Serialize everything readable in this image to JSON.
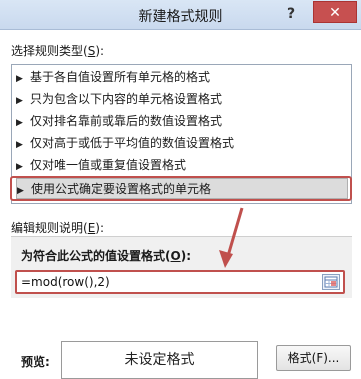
{
  "dialog": {
    "title": "新建格式规则",
    "help": "?",
    "close": "✕"
  },
  "rule_type": {
    "label_prefix": "选择规则类型(",
    "label_key": "S",
    "label_suffix": "):",
    "items": [
      "基于各自值设置所有单元格的格式",
      "只为包含以下内容的单元格设置格式",
      "仅对排名靠前或靠后的数值设置格式",
      "仅对高于或低于平均值的数值设置格式",
      "仅对唯一值或重复值设置格式",
      "使用公式确定要设置格式的单元格"
    ],
    "selected_index": 5,
    "arrow": "▶"
  },
  "description": {
    "label_prefix": "编辑规则说明(",
    "label_key": "E",
    "label_suffix": "):",
    "formula_label_prefix": "为符合此公式的值设置格式(",
    "formula_label_key": "O",
    "formula_label_suffix": "):",
    "formula_value": "=mod(row(),2)"
  },
  "preview": {
    "label": "预览:",
    "text": "未设定格式",
    "format_button": "格式(F)..."
  },
  "colors": {
    "highlight": "#c0504d",
    "titlebar": "#d0e0f3",
    "close": "#c75050"
  }
}
